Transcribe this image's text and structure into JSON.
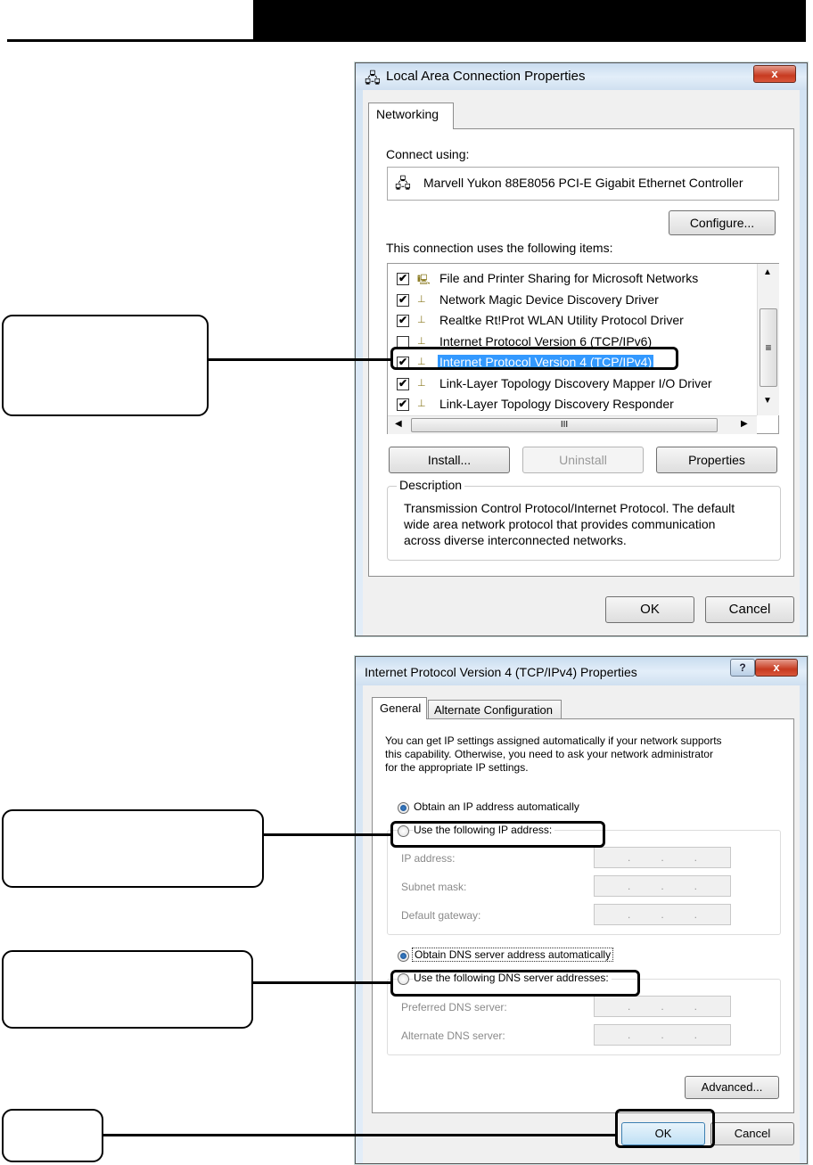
{
  "window1": {
    "title": "Local Area Connection Properties",
    "close_label": "x",
    "tab": "Networking",
    "connect_using_label": "Connect using:",
    "adapter": "Marvell Yukon 88E8056 PCI-E Gigabit Ethernet Controller",
    "configure_button": "Configure...",
    "items_label": "This connection uses the following items:",
    "items": [
      {
        "label": "File and Printer Sharing for Microsoft Networks",
        "checked": true
      },
      {
        "label": "Network Magic Device Discovery Driver",
        "checked": true
      },
      {
        "label": "Realtke Rt!Prot WLAN Utility Protocol Driver",
        "checked": true
      },
      {
        "label": "Internet Protocol Version 6 (TCP/IPv6)",
        "checked": false
      },
      {
        "label": "Internet Protocol Version 4 (TCP/IPv4)",
        "checked": true,
        "selected": true
      },
      {
        "label": "Link-Layer Topology Discovery Mapper I/O Driver",
        "checked": true
      },
      {
        "label": "Link-Layer Topology Discovery Responder",
        "checked": true
      }
    ],
    "scroll_thumb_glyph": "≡",
    "hscroll_thumb_glyph": "III",
    "install_button": "Install...",
    "uninstall_button": "Uninstall",
    "properties_button": "Properties",
    "description_label": "Description",
    "description_lines": [
      "Transmission Control Protocol/Internet Protocol. The default",
      "wide area network protocol that provides communication",
      "across diverse interconnected networks."
    ],
    "ok_button": "OK",
    "cancel_button": "Cancel"
  },
  "window2": {
    "title": "Internet Protocol Version 4 (TCP/IPv4) Properties",
    "help_label": "?",
    "close_label": "x",
    "tab_general": "General",
    "tab_alternate": "Alternate Configuration",
    "intro_lines": [
      "You can get IP settings assigned automatically if your network supports",
      "this capability. Otherwise, you need to ask your network administrator",
      "for the appropriate IP settings."
    ],
    "obtain_ip_auto": "Obtain an IP address automatically",
    "use_following_ip": "Use the following IP address:",
    "ip_address_label": "IP address:",
    "subnet_mask_label": "Subnet mask:",
    "default_gateway_label": "Default gateway:",
    "obtain_dns_auto": "Obtain DNS server address automatically",
    "use_following_dns": "Use the following DNS server addresses:",
    "preferred_dns_label": "Preferred DNS server:",
    "alternate_dns_label": "Alternate DNS server:",
    "ip_dot": ".",
    "advanced_button": "Advanced...",
    "ok_button": "OK",
    "cancel_button": "Cancel"
  }
}
